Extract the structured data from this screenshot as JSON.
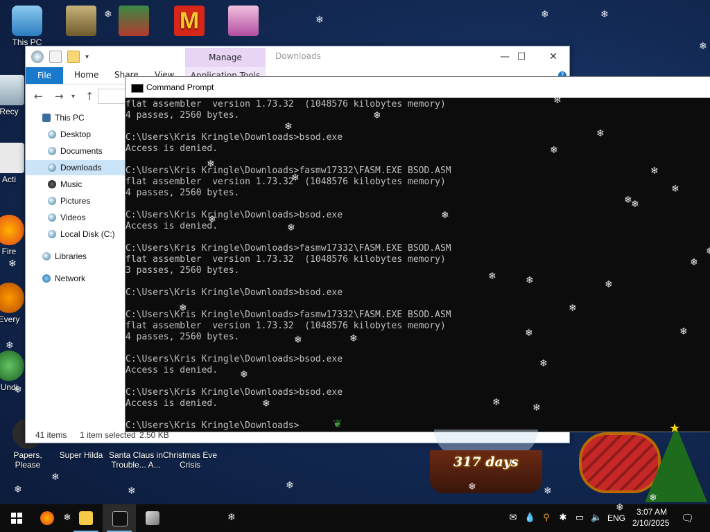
{
  "desktop": {
    "icons": [
      {
        "label": "This PC"
      },
      {
        "label": "Recy"
      },
      {
        "label": "Acti"
      },
      {
        "label": "Fire"
      },
      {
        "label": "Every"
      },
      {
        "label": "Undi"
      },
      {
        "label": "Papers, Please"
      },
      {
        "label": "Super Hilda"
      },
      {
        "label": "Santa Claus in Trouble... A..."
      },
      {
        "label": "Christmas Eve Crisis"
      }
    ],
    "snow_glyph": "❄"
  },
  "explorer": {
    "manage_tab": "Manage",
    "title": "Downloads",
    "ribbon": {
      "file": "File",
      "home": "Home",
      "share": "Share",
      "view": "View",
      "app_tools": "Application Tools"
    },
    "controls": {
      "minimize": "—",
      "maximize": "☐",
      "close": "✕"
    },
    "nav": {
      "this_pc": "This PC",
      "desktop": "Desktop",
      "documents": "Documents",
      "downloads": "Downloads",
      "music": "Music",
      "pictures": "Pictures",
      "videos": "Videos",
      "local_disk": "Local Disk (C:)",
      "libraries": "Libraries",
      "network": "Network"
    },
    "status": {
      "items": "41 items",
      "selected": "1 item selected",
      "size": "2.50 KB"
    }
  },
  "cmd": {
    "title": "Command Prompt",
    "lines": [
      "flat assembler  version 1.73.32  (1048576 kilobytes memory)",
      "4 passes, 2560 bytes.",
      "",
      "C:\\Users\\Kris Kringle\\Downloads>bsod.exe",
      "Access is denied.",
      "",
      "C:\\Users\\Kris Kringle\\Downloads>fasmw17332\\FASM.EXE BSOD.ASM",
      "flat assembler  version 1.73.32  (1048576 kilobytes memory)",
      "4 passes, 2560 bytes.",
      "",
      "C:\\Users\\Kris Kringle\\Downloads>bsod.exe",
      "Access is denied.",
      "",
      "C:\\Users\\Kris Kringle\\Downloads>fasmw17332\\FASM.EXE BSOD.ASM",
      "flat assembler  version 1.73.32  (1048576 kilobytes memory)",
      "3 passes, 2560 bytes.",
      "",
      "C:\\Users\\Kris Kringle\\Downloads>bsod.exe",
      "",
      "C:\\Users\\Kris Kringle\\Downloads>fasmw17332\\FASM.EXE BSOD.ASM",
      "flat assembler  version 1.73.32  (1048576 kilobytes memory)",
      "4 passes, 2560 bytes.",
      "",
      "C:\\Users\\Kris Kringle\\Downloads>bsod.exe",
      "Access is denied.",
      "",
      "C:\\Users\\Kris Kringle\\Downloads>bsod.exe",
      "Access is denied.",
      "",
      "C:\\Users\\Kris Kringle\\Downloads>"
    ]
  },
  "countdown": {
    "days": "317 days"
  },
  "taskbar": {
    "language": "ENG",
    "time": "3:07 AM",
    "date": "2/10/2025",
    "apps": [
      "start-icon",
      "firefox-icon",
      "snowflake-icon",
      "file-explorer-icon",
      "command-prompt-icon",
      "network-tool-icon"
    ]
  },
  "colors": {
    "console_bg": "#0c0c0c",
    "console_fg": "#c0c0c0",
    "file_tab": "#1979ca",
    "manage_tab": "#e8d4f5",
    "selection": "#cce4f7"
  }
}
